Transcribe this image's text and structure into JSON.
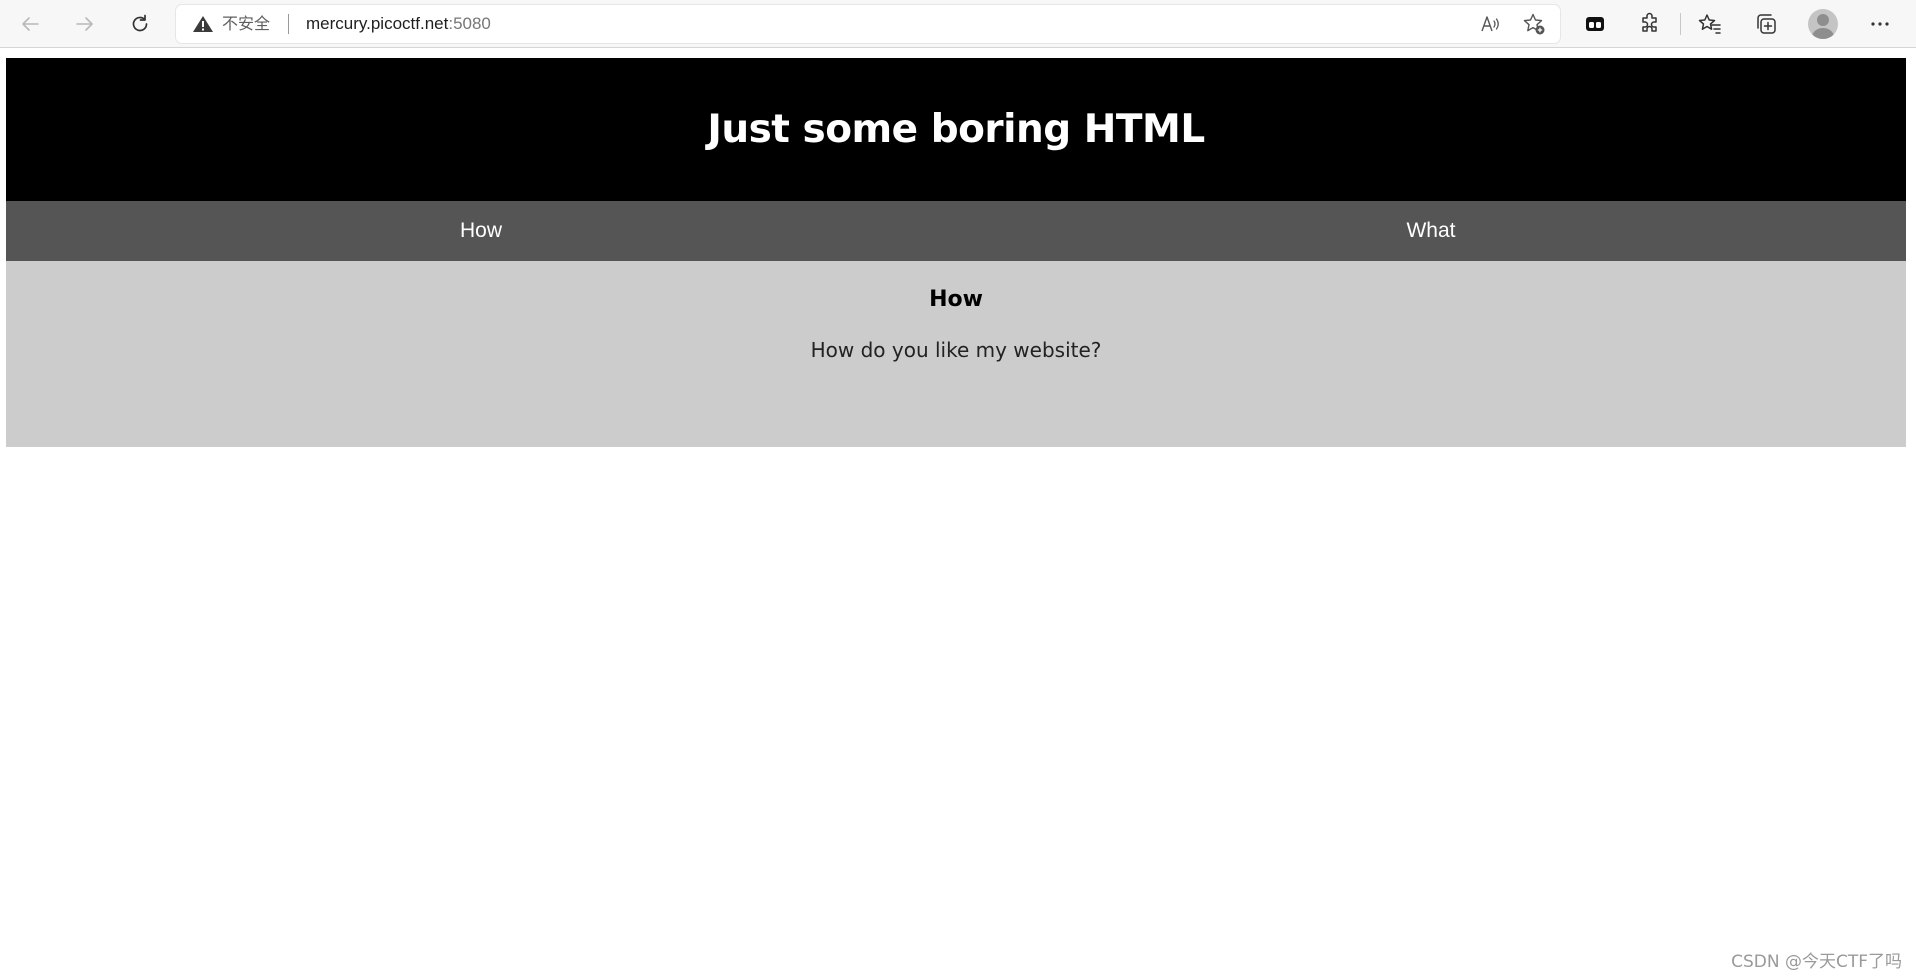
{
  "browser": {
    "address": {
      "security_label": "不安全",
      "host": "mercury.picoctf.net",
      "port": ":5080"
    },
    "icons": {
      "back": "back-arrow-icon",
      "forward": "forward-arrow-icon",
      "refresh": "refresh-icon",
      "warning": "warning-icon",
      "read_aloud": "read-aloud-icon",
      "add_favorite": "add-favorite-icon",
      "extension": "extension-icon",
      "puzzle": "extensions-icon",
      "favorites": "favorites-icon",
      "collections": "collections-icon",
      "profile": "profile-avatar",
      "menu": "more-menu-icon"
    }
  },
  "site": {
    "title": "Just some boring HTML",
    "nav": {
      "tabs": [
        {
          "label": "How"
        },
        {
          "label": "What"
        }
      ]
    },
    "section": {
      "heading": "How",
      "text": "How do you like my website?"
    },
    "colors": {
      "header_bg": "#000000",
      "nav_bg": "#555555",
      "content_bg": "#cccccc"
    }
  },
  "watermark": "CSDN @今天CTF了吗"
}
